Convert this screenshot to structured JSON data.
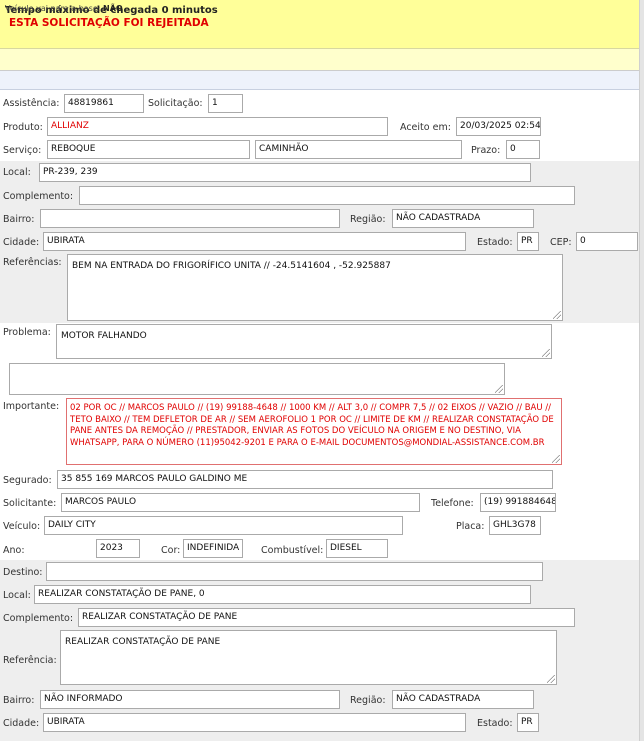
{
  "banner": {
    "message": "ESTA SOLICITAÇÃO FOI REJEITADA"
  },
  "tempo": {
    "text": "Tempo máximo de chegada 0 minutos"
  },
  "base": {
    "label": "Veículo vai para a base:",
    "value": "NÃO"
  },
  "header": {
    "assistencia_label": "Assistência:",
    "assistencia": "48819861",
    "solicitacao_label": "Solicitação:",
    "solicitacao": "1",
    "produto_label": "Produto:",
    "produto": "ALLIANZ",
    "aceito_label": "Aceito em:",
    "aceito": "20/03/2025 02:54",
    "servico_label": "Serviço:",
    "servico": "REBOQUE",
    "servico2": "CAMINHÃO",
    "prazo_label": "Prazo:",
    "prazo": "0"
  },
  "origem": {
    "local_label": "Local:",
    "local": "PR-239, 239",
    "complemento_label": "Complemento:",
    "complemento": "",
    "bairro_label": "Bairro:",
    "bairro": "",
    "regiao_label": "Região:",
    "regiao": "NÃO CADASTRADA",
    "cidade_label": "Cidade:",
    "cidade": "UBIRATA",
    "estado_label": "Estado:",
    "estado": "PR",
    "cep_label": "CEP:",
    "cep": "0",
    "referencias_label": "Referências:",
    "referencias": "BEM NA ENTRADA DO FRIGORÍFICO UNITA // -24.5141604 , -52.925887"
  },
  "problema": {
    "label": "Problema:",
    "value": "MOTOR FALHANDO",
    "extra": "",
    "importante_label": "Importante:",
    "importante": "02 POR OC // MARCOS PAULO //  (19) 99188-4648 // 1000 KM // ALT 3,0  // COMPR 7,5 // 02 EIXOS // VAZIO // BAU // TETO BAIXO // TEM DEFLETOR DE AR // SEM AEROFOLIO 1 POR OC // LIMITE DE KM // REALIZAR CONSTATAÇÃO DE PANE ANTES DA REMOÇÃO // PRESTADOR, ENVIAR AS FOTOS DO VEÍCULO NA ORIGEM E NO DESTINO, VIA WHATSAPP, PARA O NÚMERO (11)95042-9201 E PARA O E-MAIL DOCUMENTOS@MONDIAL-ASSISTANCE.COM.BR"
  },
  "segurado": {
    "segurado_label": "Segurado:",
    "segurado": "35 855 169 MARCOS PAULO GALDINO ME",
    "solicitante_label": "Solicitante:",
    "solicitante": "MARCOS PAULO",
    "telefone_label": "Telefone:",
    "telefone": "(19) 991884648",
    "veiculo_label": "Veículo:",
    "veiculo": "DAILY CITY",
    "placa_label": "Placa:",
    "placa": "GHL3G78",
    "ano_label": "Ano:",
    "ano": "2023",
    "cor_label": "Cor:",
    "cor": "INDEFINIDA",
    "combustivel_label": "Combustível:",
    "combustivel": "DIESEL"
  },
  "destino": {
    "destino_label": "Destino:",
    "destino": "",
    "local_label": "Local:",
    "local": "REALIZAR CONSTATAÇÃO DE PANE, 0",
    "complemento_label": "Complemento:",
    "complemento": "REALIZAR CONSTATAÇÃO DE PANE",
    "referencia_label": "Referência:",
    "referencia": "REALIZAR CONSTATAÇÃO DE PANE",
    "bairro_label": "Bairro:",
    "bairro": "NÃO INFORMADO",
    "regiao_label": "Região:",
    "regiao": "NÃO CADASTRADA",
    "cidade_label": "Cidade:",
    "cidade": "UBIRATA",
    "estado_label": "Estado:",
    "estado": "PR"
  },
  "colors": {
    "banner_bg": "#ffff99",
    "alert": "#e00000",
    "section_gray": "#eeeeee"
  }
}
